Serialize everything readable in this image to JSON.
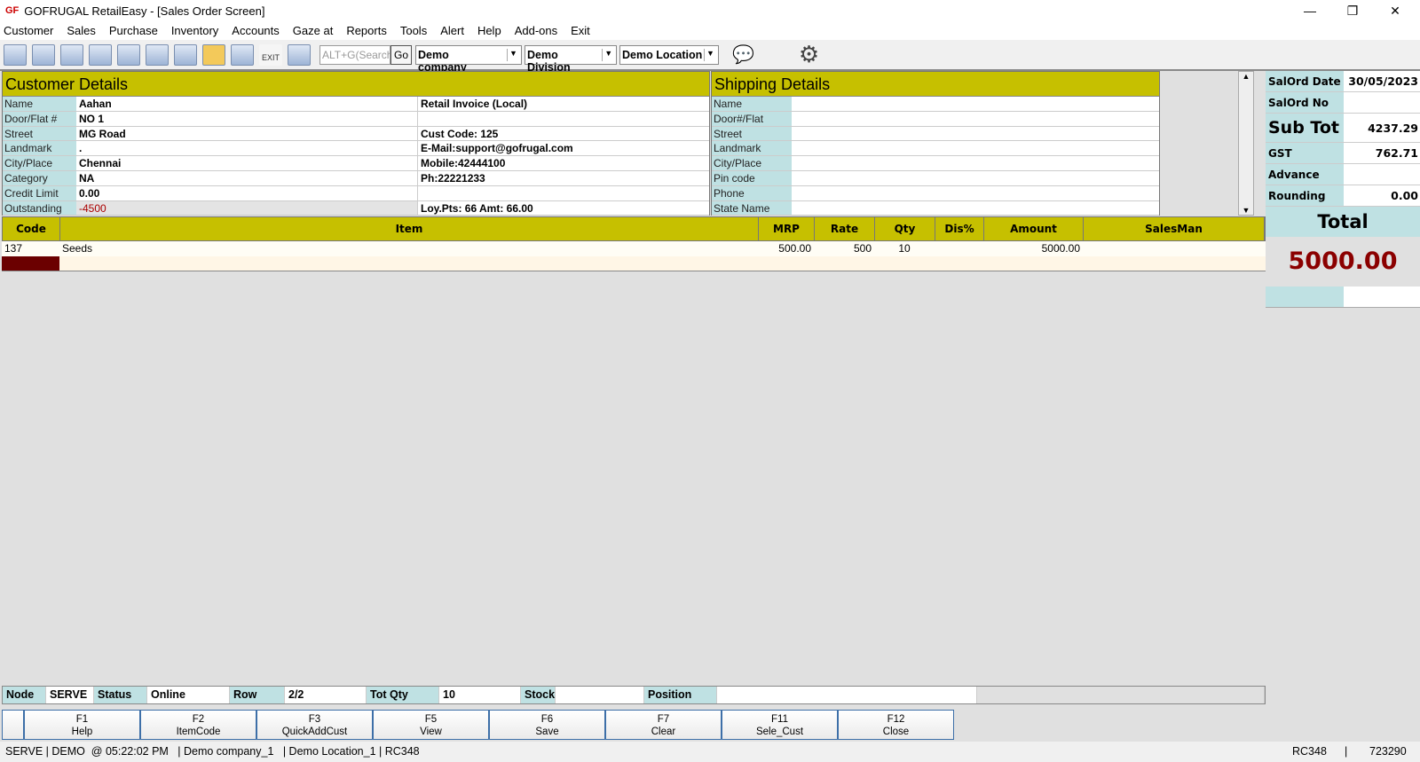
{
  "window": {
    "title": "GOFRUGAL RetailEasy - [Sales Order Screen]",
    "logo": "GF",
    "min": "—",
    "restore": "❐",
    "close": "✕"
  },
  "menu": [
    "Customer",
    "Sales",
    "Purchase",
    "Inventory",
    "Accounts",
    "Gaze at",
    "Reports",
    "Tools",
    "Alert",
    "Help",
    "Add-ons",
    "Exit"
  ],
  "toolbar": {
    "search_placeholder": "ALT+G(Search",
    "go": "Go",
    "company": "Demo company_",
    "division": "Demo Division",
    "location": "Demo Location",
    "exit_label": "EXIT",
    "gear": "⚙",
    "chat": "💬"
  },
  "customer": {
    "title": "Customer Details",
    "rows": [
      {
        "label": "Name",
        "value": "Aahan",
        "extra": "Retail Invoice (Local)"
      },
      {
        "label": "Door/Flat #",
        "value": "NO 1",
        "extra": ""
      },
      {
        "label": "Street",
        "value": "MG Road",
        "extra": "Cust Code: 125"
      },
      {
        "label": "Landmark",
        "value": ".",
        "extra": "E-Mail:support@gofrugal.com"
      },
      {
        "label": "City/Place",
        "value": "Chennai",
        "extra": "Mobile:42444100"
      },
      {
        "label": "Category",
        "value": "NA",
        "extra": "Ph:22221233"
      },
      {
        "label": "Credit Limit",
        "value": "0.00",
        "extra": ""
      },
      {
        "label": "Outstanding",
        "value": "-4500",
        "extra": "Loy.Pts: 66  Amt: 66.00"
      }
    ]
  },
  "shipping": {
    "title": "Shipping Details",
    "labels": [
      "Name",
      "Door#/Flat",
      "Street",
      "Landmark",
      "City/Place",
      "Pin code",
      "Phone",
      "State Name"
    ]
  },
  "grid": {
    "headers": [
      "Code",
      "Item",
      "MRP",
      "Rate",
      "Qty",
      "Dis%",
      "Amount",
      "SalesMan"
    ],
    "rows": [
      {
        "code": "137",
        "item": "Seeds",
        "mrp": "500.00",
        "rate": "500",
        "qty": "10",
        "dis": "",
        "amount": "5000.00",
        "salesman": ""
      }
    ]
  },
  "summary": {
    "rows": [
      {
        "label": "SalOrd Date",
        "value": "30/05/2023"
      },
      {
        "label": "SalOrd No",
        "value": ""
      },
      {
        "label": "Sub Tot",
        "value": "4237.29"
      },
      {
        "label": "GST",
        "value": "762.71"
      },
      {
        "label": "Advance",
        "value": ""
      },
      {
        "label": "Rounding",
        "value": "0.00"
      }
    ],
    "total_label": "Total",
    "total": "5000.00",
    "accent": "#8b0000"
  },
  "status": {
    "node_label": "Node",
    "node": "SERVE",
    "status_label": "Status",
    "status": "Online",
    "row_label": "Row",
    "row": "2/2",
    "totqty_label": "Tot Qty",
    "totqty": "10",
    "stock_label": "Stock",
    "stock": "",
    "position_label": "Position",
    "position": ""
  },
  "fkeys": [
    {
      "key": "F1",
      "label": "Help"
    },
    {
      "key": "F2",
      "label": "ItemCode"
    },
    {
      "key": "F3",
      "label": "QuickAddCust"
    },
    {
      "key": "F5",
      "label": "View"
    },
    {
      "key": "F6",
      "label": "Save"
    },
    {
      "key": "F7",
      "label": "Clear"
    },
    {
      "key": "F11",
      "label": "Sele_Cust"
    },
    {
      "key": "F12",
      "label": "Close"
    }
  ],
  "footer": {
    "left": "SERVE | DEMO  @ 05:22:02 PM   | Demo company_1   | Demo Location_1 | RC348",
    "right1": "RC348",
    "sep": "|",
    "right2": "723290"
  }
}
